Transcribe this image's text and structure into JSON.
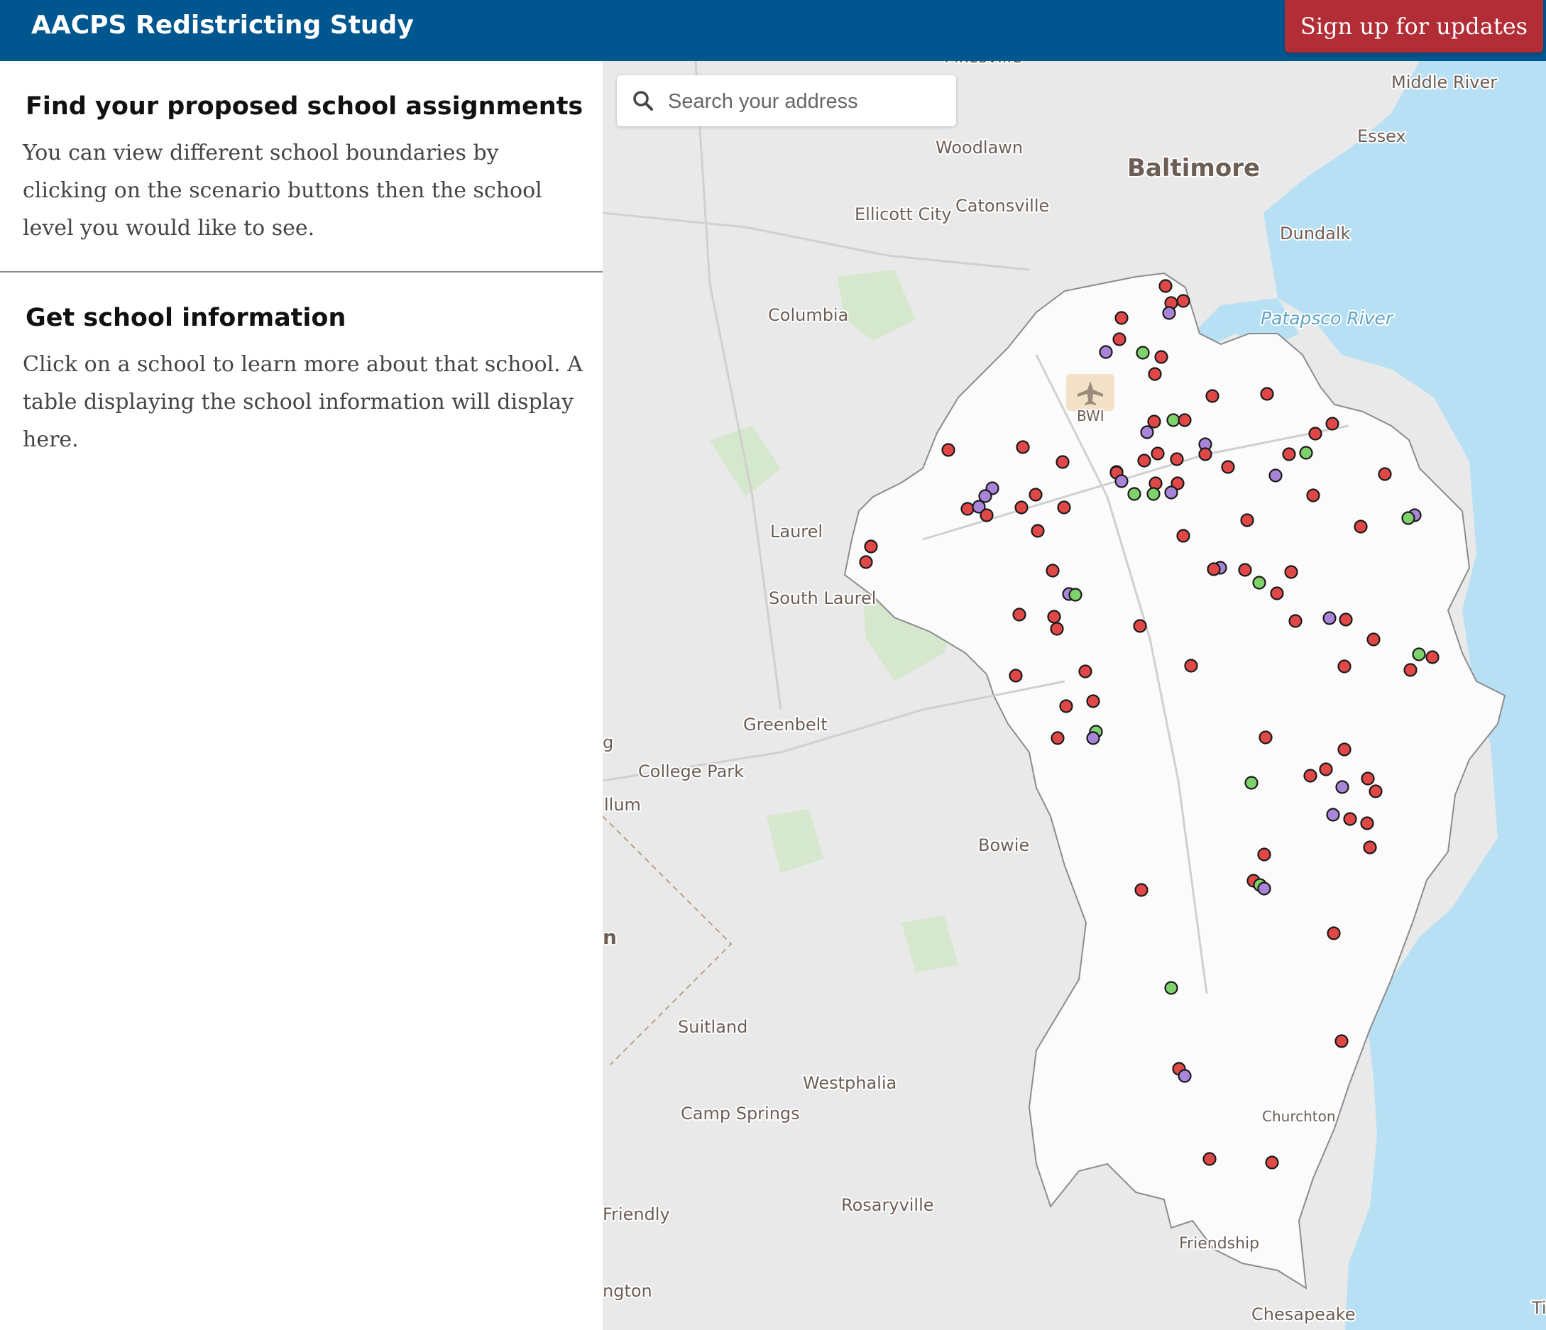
{
  "header": {
    "title": "AACPS Redistricting Study",
    "signup_label": "Sign up for updates"
  },
  "sidebar": {
    "assignments": {
      "heading": "Find your proposed school assignments",
      "body": "You can view different school boundaries by clicking on the scenario buttons then the school level you would like to see."
    },
    "info": {
      "heading": "Get school information",
      "body": "Click on a school to learn more about that school. A table displaying the school information will display here."
    }
  },
  "map": {
    "search_placeholder": "Search your address",
    "search_icon": "search-icon",
    "airport_icon": "airplane-icon",
    "place_labels": [
      "Baltimore",
      "Middle River",
      "Essex",
      "Woodlawn",
      "Ellicott City",
      "Catonsville",
      "Dundalk",
      "Patapsco River",
      "Columbia",
      "BWI",
      "Laurel",
      "South Laurel",
      "Greenbelt",
      "College Park",
      "llum",
      "g",
      "Bowie",
      "n",
      "Suitland",
      "Westphalia",
      "Camp Springs",
      "Churchton",
      "Friendly",
      "Rosaryville",
      "Friendship",
      "ngton",
      "Chesapeake",
      "Ti",
      "Pikesville"
    ],
    "colors": {
      "water": "#b7e0f5",
      "land": "#e9e9e9",
      "county": "#fbfbfb",
      "school_red": "#e04848",
      "school_green": "#7fd16b",
      "school_purple": "#a885d8"
    },
    "school_marker_colors": [
      "red",
      "green",
      "purple"
    ]
  }
}
